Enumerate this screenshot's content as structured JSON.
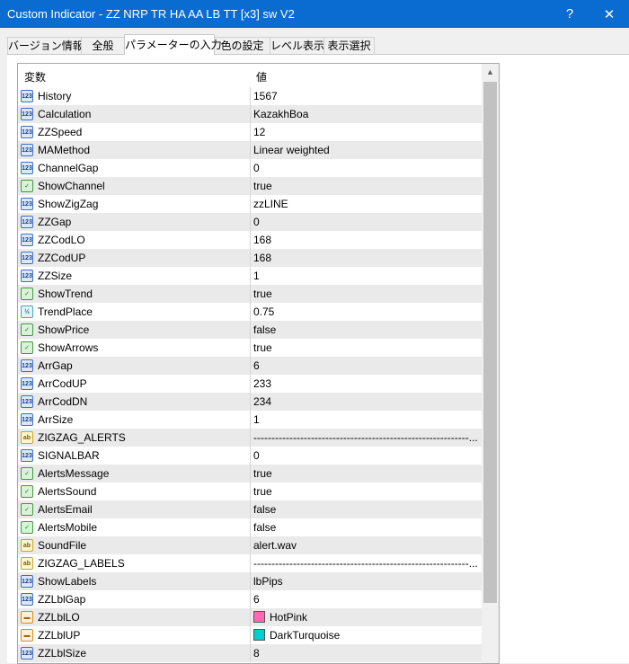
{
  "window": {
    "title": "Custom Indicator - ZZ NRP TR HA AA LB TT [x3] sw V2",
    "help_label": "?",
    "close_label": "✕"
  },
  "tabs": [
    {
      "label": "バージョン情報",
      "active": false
    },
    {
      "label": "全般",
      "active": false
    },
    {
      "label": "パラメーターの入力",
      "active": true
    },
    {
      "label": "色の設定",
      "active": false
    },
    {
      "label": "レベル表示",
      "active": false
    },
    {
      "label": "表示選択",
      "active": false
    }
  ],
  "grid": {
    "columns": {
      "name": "変数",
      "value": "値"
    },
    "scroll_up_label": "▲",
    "type_icons": {
      "int": "123",
      "bool": "✓",
      "dbl": "½",
      "str": "ab",
      "clr": "▬"
    },
    "rows": [
      {
        "type": "int",
        "name": "History",
        "value": "1567"
      },
      {
        "type": "int",
        "name": "Calculation",
        "value": "KazakhBoa"
      },
      {
        "type": "int",
        "name": "ZZSpeed",
        "value": "12"
      },
      {
        "type": "int",
        "name": "MAMethod",
        "value": "Linear weighted"
      },
      {
        "type": "int",
        "name": "ChannelGap",
        "value": "0"
      },
      {
        "type": "bool",
        "name": "ShowChannel",
        "value": "true"
      },
      {
        "type": "int",
        "name": "ShowZigZag",
        "value": "zzLINE"
      },
      {
        "type": "int",
        "name": "ZZGap",
        "value": "0"
      },
      {
        "type": "int",
        "name": "ZZCodLO",
        "value": "168"
      },
      {
        "type": "int",
        "name": "ZZCodUP",
        "value": "168"
      },
      {
        "type": "int",
        "name": "ZZSize",
        "value": "1"
      },
      {
        "type": "bool",
        "name": "ShowTrend",
        "value": "true"
      },
      {
        "type": "dbl",
        "name": "TrendPlace",
        "value": "0.75"
      },
      {
        "type": "bool",
        "name": "ShowPrice",
        "value": "false"
      },
      {
        "type": "bool",
        "name": "ShowArrows",
        "value": "true"
      },
      {
        "type": "int",
        "name": "ArrGap",
        "value": "6"
      },
      {
        "type": "int",
        "name": "ArrCodUP",
        "value": "233"
      },
      {
        "type": "int",
        "name": "ArrCodDN",
        "value": "234"
      },
      {
        "type": "int",
        "name": "ArrSize",
        "value": "1"
      },
      {
        "type": "str",
        "name": "ZIGZAG_ALERTS",
        "value": "------------------------------------------------------------..."
      },
      {
        "type": "int",
        "name": "SIGNALBAR",
        "value": "0"
      },
      {
        "type": "bool",
        "name": "AlertsMessage",
        "value": "true"
      },
      {
        "type": "bool",
        "name": "AlertsSound",
        "value": "true"
      },
      {
        "type": "bool",
        "name": "AlertsEmail",
        "value": "false"
      },
      {
        "type": "bool",
        "name": "AlertsMobile",
        "value": "false"
      },
      {
        "type": "str",
        "name": "SoundFile",
        "value": "alert.wav"
      },
      {
        "type": "str",
        "name": "ZIGZAG_LABELS",
        "value": "------------------------------------------------------------..."
      },
      {
        "type": "int",
        "name": "ShowLabels",
        "value": "lbPips"
      },
      {
        "type": "int",
        "name": "ZZLblGap",
        "value": "6"
      },
      {
        "type": "clr",
        "name": "ZZLblLO",
        "value": "HotPink",
        "color": "#ff69b4"
      },
      {
        "type": "clr",
        "name": "ZZLblUP",
        "value": "DarkTurquoise",
        "color": "#00ced1"
      },
      {
        "type": "int",
        "name": "ZZLblSize",
        "value": "8"
      }
    ]
  }
}
